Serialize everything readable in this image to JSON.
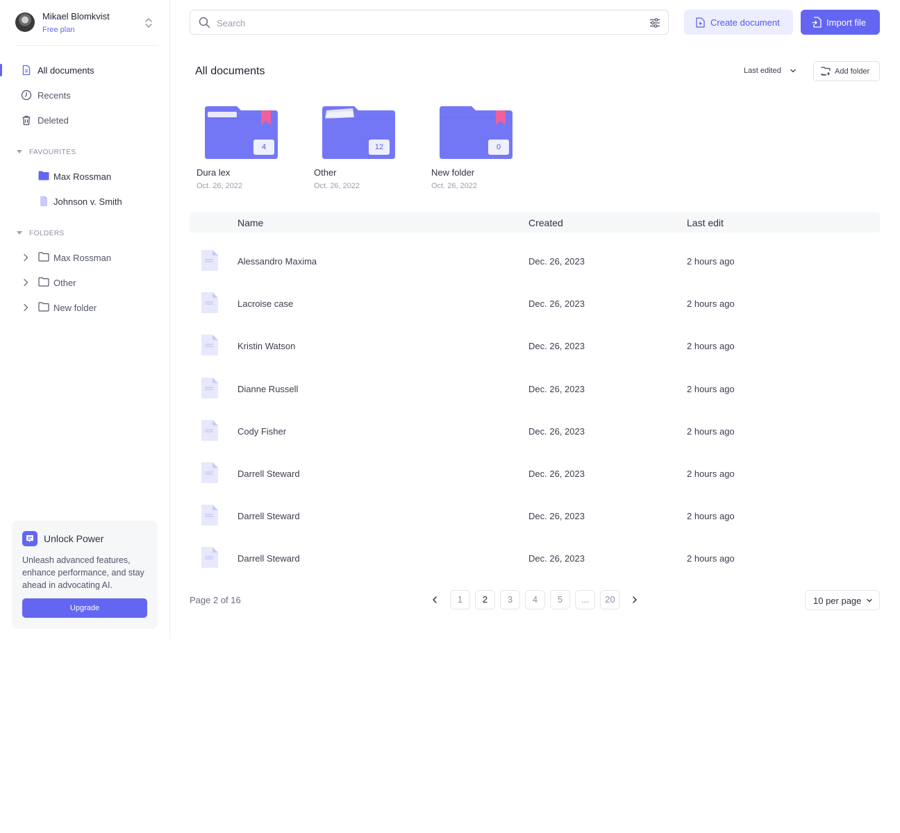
{
  "user": {
    "name": "Mikael Blomkvist",
    "plan": "Free plan"
  },
  "nav": [
    {
      "label": "All documents",
      "icon": "document-icon",
      "active": true
    },
    {
      "label": "Recents",
      "icon": "clock-icon"
    },
    {
      "label": "Deleted",
      "icon": "trash-icon"
    }
  ],
  "favourites": {
    "title": "FAVOURITES",
    "items": [
      {
        "label": "Max Rossman",
        "icon": "folder-filled-icon"
      },
      {
        "label": "Johnson v. Smith",
        "icon": "file-icon"
      }
    ]
  },
  "folders": {
    "title": "FOLDERS",
    "items": [
      {
        "label": "Max Rossman"
      },
      {
        "label": "Other"
      },
      {
        "label": "New folder"
      }
    ]
  },
  "promo": {
    "title": "Unlock Power",
    "text": "Unleash advanced features, enhance performance, and stay ahead in advocating AI.",
    "button": "Upgrade"
  },
  "search": {
    "placeholder": "Search"
  },
  "toolbar": {
    "create": "Create document",
    "import": "Import file"
  },
  "main": {
    "title": "All documents",
    "sort": "Last edited",
    "add_folder": "Add folder"
  },
  "folder_cards": [
    {
      "name": "Dura lex",
      "date": "Oct. 26, 2022",
      "count": "4",
      "bookmarked": true
    },
    {
      "name": "Other",
      "date": "Oct. 26, 2022",
      "count": "12",
      "bookmarked": false
    },
    {
      "name": "New folder",
      "date": "Oct. 26, 2022",
      "count": "0",
      "bookmarked": true
    }
  ],
  "table": {
    "headers": [
      "Name",
      "Created",
      "Last edit"
    ],
    "rows": [
      {
        "name": "Alessandro Maxima",
        "created": "Dec. 26, 2023",
        "edit": "2 hours ago"
      },
      {
        "name": "Lacroise case",
        "created": "Dec. 26, 2023",
        "edit": "2 hours ago"
      },
      {
        "name": "Kristin Watson",
        "created": "Dec. 26, 2023",
        "edit": "2 hours ago"
      },
      {
        "name": "Dianne Russell",
        "created": "Dec. 26, 2023",
        "edit": "2 hours ago"
      },
      {
        "name": "Cody Fisher",
        "created": "Dec. 26, 2023",
        "edit": "2 hours ago"
      },
      {
        "name": "Darrell Steward",
        "created": "Dec. 26, 2023",
        "edit": "2 hours ago"
      },
      {
        "name": "Darrell Steward",
        "created": "Dec. 26, 2023",
        "edit": "2 hours ago"
      },
      {
        "name": "Darrell Steward",
        "created": "Dec. 26, 2023",
        "edit": "2 hours ago"
      }
    ]
  },
  "pagination": {
    "info": "Page 2 of 16",
    "pages": [
      "1",
      "2",
      "3",
      "4",
      "5",
      "...",
      "20"
    ],
    "current": "2",
    "per_page": "10 per page"
  },
  "colors": {
    "accent": "#6366f1",
    "folder": "#7477f5",
    "bookmark": "#f0609a"
  }
}
